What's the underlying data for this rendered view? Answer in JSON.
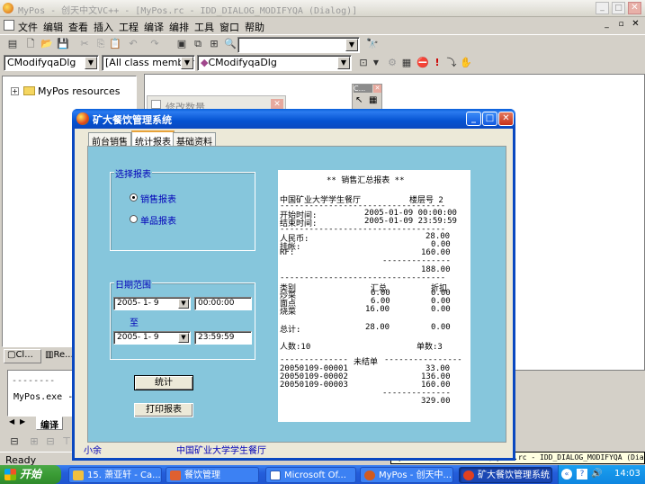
{
  "ide": {
    "title": "MyPos - 创天中文VC++ - [MyPos.rc - IDD_DIALOG_MODIFYQA (Dialog)]",
    "menu": [
      "文件",
      "编辑",
      "查看",
      "插入",
      "工程",
      "编译",
      "编排",
      "工具",
      "窗口",
      "帮助"
    ],
    "class_combo": "CModifyqaDlg",
    "members_combo": "[All class members]",
    "function_combo": "CModifyqaDlg",
    "tree_root": "MyPos resources",
    "tab_classview": "Cl...",
    "tab_resourceview": "Re...",
    "output_text": "MyPos.exe -",
    "output_tab": "编译",
    "status": "Ready",
    "tooltip": "MyPos - 创天中文VC++ - [MyPos.rc - IDD_DIALOG_MODIFYQA (Dialog)]",
    "controls_caption": "C...",
    "design_dialog_title": "修改数量"
  },
  "app": {
    "title": "矿大餐饮管理系统",
    "tabs": [
      "前台销售",
      "统计报表",
      "基础资料"
    ],
    "select_group": "选择报表",
    "radio_sales": "销售报表",
    "radio_item": "单品报表",
    "date_group": "日期范围",
    "date_from": "2005- 1- 9",
    "time_from": "00:00:00",
    "to_label": "至",
    "date_to": "2005- 1- 9",
    "time_to": "23:59:59",
    "btn_stats": "统计",
    "btn_print": "打印报表",
    "footer_user": "小余",
    "footer_org": "中国矿业大学学生餐厅",
    "report": {
      "title": "** 销售汇总报表 **",
      "restaurant": "中国矿业大学学生餐厅",
      "floor": "楼层号 2",
      "start_label": "开始时间:",
      "start_value": "2005-01-09 00:00:00",
      "end_label": "结束时间:",
      "end_value": "2005-01-09 23:59:59",
      "rmb_label": "人民币:",
      "rmb_value": "28.00",
      "credit_label": "挂帐:",
      "credit_value": "0.00",
      "rf_label": "RF:",
      "rf_value": "160.00",
      "sum1": "188.00",
      "col_cat": "类别",
      "col_total": "汇总",
      "col_discount": "折扣",
      "rows": [
        {
          "cat": "炒菜",
          "total": "6.00",
          "disc": "0.00"
        },
        {
          "cat": "面点",
          "total": "6.00",
          "disc": "0.00"
        },
        {
          "cat": "烧菜",
          "total": "16.00",
          "disc": "0.00"
        }
      ],
      "total_label": "总计:",
      "total_value": "28.00",
      "total_disc": "0.00",
      "people": "人数:10",
      "orders": "单数:3",
      "unsettled": "未结单",
      "bills": [
        {
          "no": "20050109-00001",
          "amt": "33.00"
        },
        {
          "no": "20050109-00002",
          "amt": "136.00"
        },
        {
          "no": "20050109-00003",
          "amt": "160.00"
        }
      ],
      "bills_total": "329.00"
    }
  },
  "taskbar": {
    "start": "开始",
    "items": [
      "15. 萧亚轩 - Ca...",
      "餐饮管理",
      "Microsoft Of...",
      "MyPos - 创天中...",
      "矿大餐饮管理系统"
    ],
    "time": "14:03"
  }
}
